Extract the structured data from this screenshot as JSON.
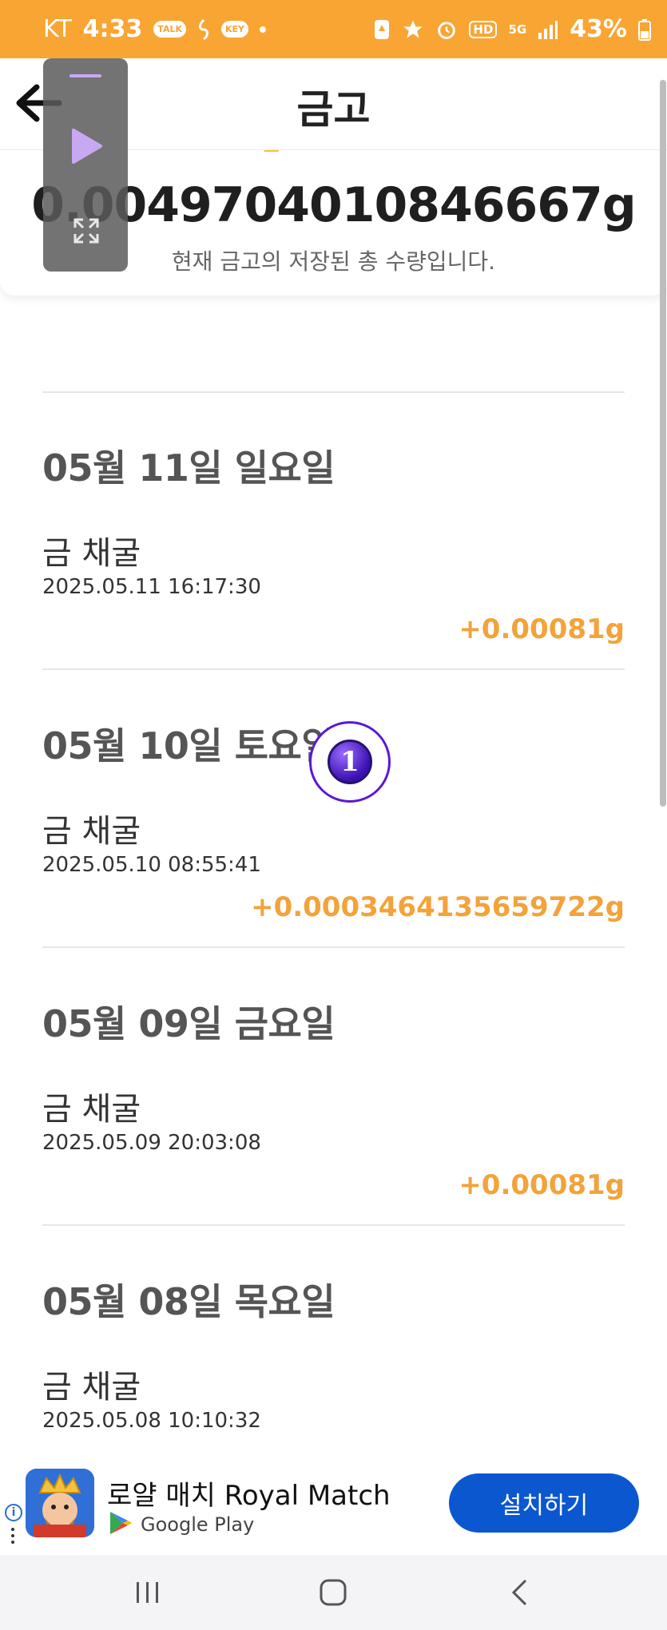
{
  "status_bar": {
    "carrier": "KT",
    "time": "4:33",
    "talk_label": "TALK",
    "key_label": "KEY",
    "hd_label": "HD",
    "net_label": "5G",
    "battery": "43%"
  },
  "header": {
    "title": "금고"
  },
  "summary": {
    "total": "0.0049704010846667g",
    "caption": "현재 금고의 저장된 총 수량입니다."
  },
  "days": [
    {
      "date": "05월 11일 일요일",
      "item_title": "금 채굴",
      "time": "2025.05.11 16:17:30",
      "amount": "+0.00081g"
    },
    {
      "date": "05월 10일 토요일",
      "item_title": "금 채굴",
      "time": "2025.05.10 08:55:41",
      "amount": "+0.0003464135659722g"
    },
    {
      "date": "05월 09일 금요일",
      "item_title": "금 채굴",
      "time": "2025.05.09 20:03:08",
      "amount": "+0.00081g"
    },
    {
      "date": "05월 08일 목요일",
      "item_title": "금 채굴",
      "time": "2025.05.08 10:10:32",
      "amount": ""
    }
  ],
  "badge": {
    "number": "1"
  },
  "ad": {
    "app_name": "로얄 매치 Royal Match",
    "store_name": "Google Play",
    "install_label": "설치하기",
    "info_label": "i"
  },
  "colors": {
    "status_bar": "#f9a534",
    "amount": "#f2a33a",
    "install_button": "#0b57d0",
    "badge_ring": "#5a18d8"
  },
  "icons": [
    "back-arrow-icon",
    "play-icon",
    "expand-icon",
    "talk-icon",
    "key-icon",
    "star-icon",
    "alarm-icon",
    "signal-icon",
    "battery-icon",
    "google-play-icon",
    "recent-apps-icon",
    "home-icon",
    "back-nav-icon"
  ]
}
